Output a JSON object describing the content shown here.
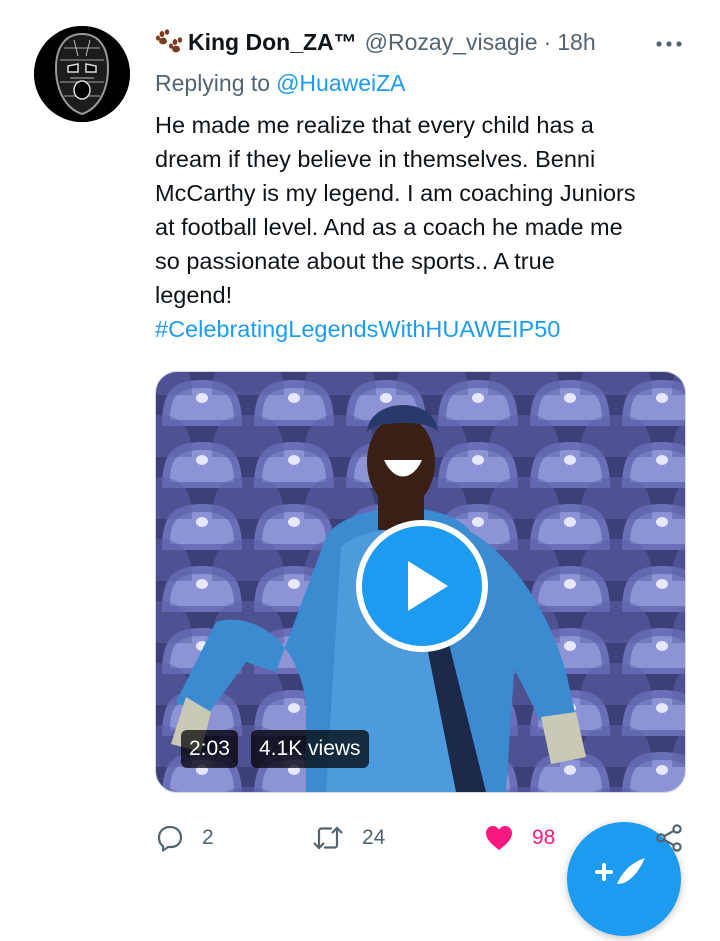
{
  "tweet": {
    "author": {
      "display_name": "King Don_ZA™",
      "handle": "@Rozay_visagie",
      "time": "18h",
      "avatar_icon": "balaclava-skull-avatar",
      "name_emoji_icon": "paw-prints-icon"
    },
    "reply": {
      "prefix": "Replying to",
      "mention": "@HuaweiZA"
    },
    "text_lines": [
      "He made me realize that every child has a",
      "dream if they believe in themselves. Benni",
      "McCarthy is my legend. I am coaching Juniors",
      "at football level. And as a coach he made me",
      "so passionate about the sports.. A true",
      "legend!"
    ],
    "hashtag": "#CelebratingLegendsWithHUAWEIP50",
    "media": {
      "duration": "2:03",
      "views": "4.1K views",
      "play_icon": "play-icon"
    },
    "actions": {
      "replies": "2",
      "retweets": "24",
      "likes": "98",
      "like_color": "#f91880"
    },
    "fab_icon": "compose-tweet-icon"
  },
  "colors": {
    "accent": "#1d9bf0",
    "secondary_text": "#536471",
    "primary_text": "#0f1419"
  }
}
